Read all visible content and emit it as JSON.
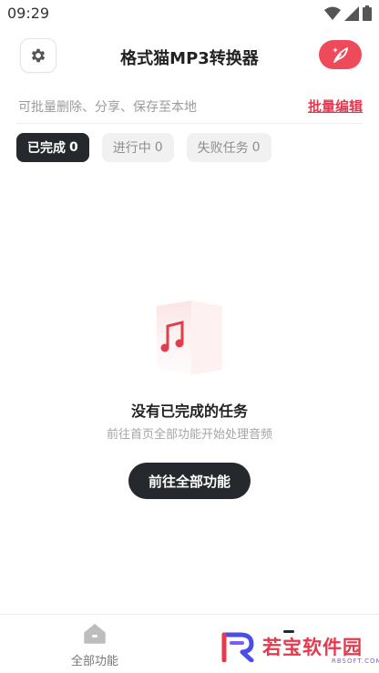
{
  "status_bar": {
    "time": "09:29"
  },
  "header": {
    "title": "格式猫MP3转换器"
  },
  "hint": {
    "text": "可批量删除、分享、保存至本地",
    "batch_edit": "批量编辑"
  },
  "tabs": [
    {
      "label": "已完成",
      "count": "0",
      "active": true
    },
    {
      "label": "进行中",
      "count": "0",
      "active": false
    },
    {
      "label": "失败任务",
      "count": "0",
      "active": false
    }
  ],
  "empty_state": {
    "title": "没有已完成的任务",
    "subtitle": "前往首页全部功能开始处理音频",
    "button": "前往全部功能"
  },
  "bottom_nav": {
    "home_label": "全部功能"
  },
  "watermark": {
    "text": "若宝软件园",
    "sub": "RBSOFT.COM"
  },
  "colors": {
    "accent": "#ee4a5a",
    "dark": "#25282c"
  }
}
